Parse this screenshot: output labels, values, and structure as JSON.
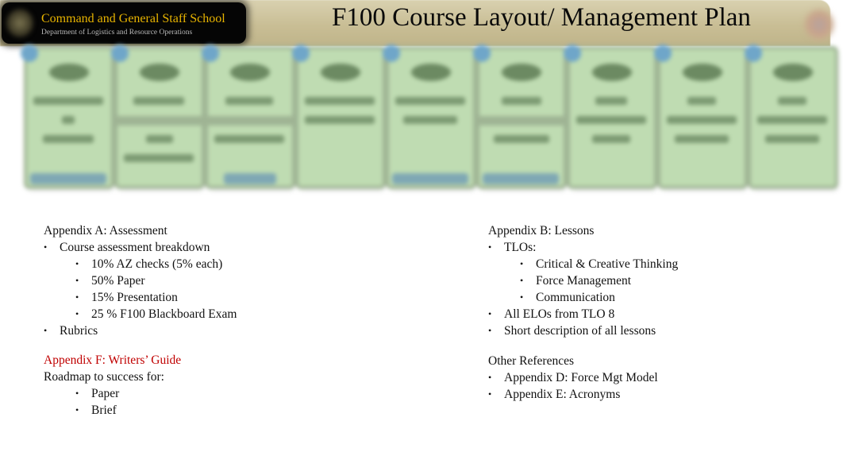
{
  "header": {
    "school_name": "Command and General Staff School",
    "department": "Department of Logistics and Resource Operations",
    "title": "F100 Course Layout/ Management Plan"
  },
  "cards": {
    "count": 9,
    "note": "card contents blurred / illegible"
  },
  "appendix_a": {
    "heading": "Appendix A: Assessment",
    "items": [
      {
        "label": "Course assessment breakdown",
        "subitems": [
          "10% AZ checks (5% each)",
          "50% Paper",
          "15% Presentation",
          "25 % F100 Blackboard Exam"
        ]
      },
      {
        "label": "Rubrics"
      }
    ]
  },
  "appendix_f": {
    "heading": "Appendix F: Writers’ Guide",
    "intro": "Roadmap to success for:",
    "subitems": [
      "Paper",
      "Brief"
    ]
  },
  "appendix_b": {
    "heading": "Appendix B: Lessons",
    "items": [
      {
        "label": "TLOs:",
        "subitems": [
          "Critical & Creative Thinking",
          "Force Management",
          "Communication"
        ]
      },
      {
        "label": "All ELOs from TLO 8"
      },
      {
        "label": "Short description of all lessons"
      }
    ]
  },
  "other_references": {
    "heading": "Other References",
    "items": [
      "Appendix D: Force Mgt Model",
      "Appendix E: Acronyms"
    ]
  },
  "colors": {
    "school_name": "#e8b400",
    "appendix_f_heading": "#c00000",
    "card_fill": "#bfdcb2",
    "banner": "#c9be95"
  }
}
